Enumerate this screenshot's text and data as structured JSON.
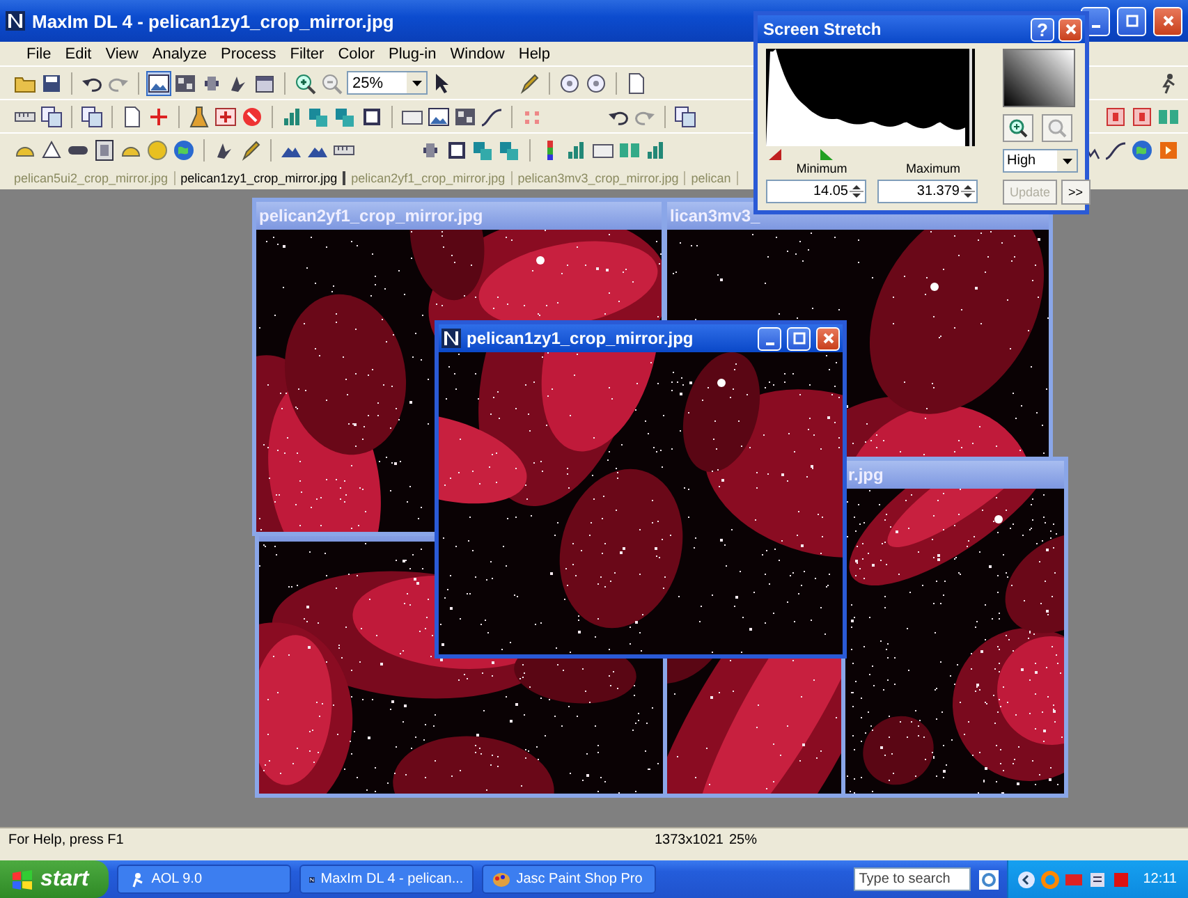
{
  "window": {
    "title": "MaxIm DL 4 - pelican1zy1_crop_mirror.jpg"
  },
  "menu": [
    "File",
    "Edit",
    "View",
    "Analyze",
    "Process",
    "Filter",
    "Color",
    "Plug-in",
    "Window",
    "Help"
  ],
  "toolbar": {
    "zoom": "25%"
  },
  "tabs": [
    {
      "label": "pelican5ui2_crop_mirror.jpg",
      "selected": false
    },
    {
      "label": "pelican1zy1_crop_mirror.jpg",
      "selected": true
    },
    {
      "label": "pelican2yf1_crop_mirror.jpg",
      "selected": false
    },
    {
      "label": "pelican3mv3_crop_mirror.jpg",
      "selected": false
    },
    {
      "label": "pelican",
      "selected": false
    }
  ],
  "documents": [
    {
      "active": false
    },
    {
      "title": "lican3mv3_",
      "active": false
    },
    {
      "title": "r.jpg",
      "active": false
    },
    {
      "title": "pelican2yf1_crop_mirror.jpg",
      "active": false
    },
    {
      "title": "pelican1zy1_crop_mirror.jpg",
      "active": true
    }
  ],
  "screen_stretch": {
    "title": "Screen Stretch",
    "help_button": "?",
    "minimum_label": "Minimum",
    "maximum_label": "Maximum",
    "minimum": "14.05",
    "maximum": "31.379",
    "quality": "High",
    "update_button": {
      "label": "Update",
      "disabled": true
    },
    "more_button": ">>"
  },
  "status_bar": {
    "help": "For Help, press F1",
    "size": "1373x1021",
    "zoom": "25%"
  },
  "taskbar": {
    "start": "start",
    "buttons": [
      "AOL 9.0",
      "MaxIm DL 4 - pelican...",
      "Jasc Paint Shop Pro"
    ],
    "search_placeholder": "Type to search",
    "clock": "12:11"
  }
}
